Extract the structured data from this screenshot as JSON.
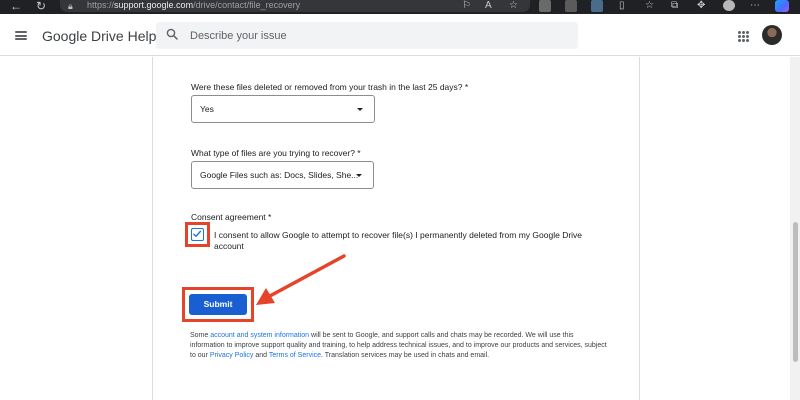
{
  "browser": {
    "url_prefix": "https://",
    "url_domain": "support.google.com",
    "url_path": "/drive/contact/file_recovery"
  },
  "header": {
    "title": "Google Drive Help",
    "search_placeholder": "Describe your issue"
  },
  "form": {
    "q1_label": "Were these files deleted or removed from your trash in the last 25 days? *",
    "q1_value": "Yes",
    "q2_label": "What type of files are you trying to recover? *",
    "q2_value": "Google Files such as: Docs, Slides, She...",
    "consent_label": "Consent agreement *",
    "consent_text": "I consent to allow Google to attempt to recover file(s) I permanently deleted from my Google Drive account",
    "consent_checked": true,
    "submit_label": "Submit"
  },
  "disclaimer": {
    "part1": "Some ",
    "link1": "account and system information",
    "part2": " will be sent to Google, and support calls and chats may be recorded. We will use this information to improve support quality and training, to help address technical issues, and to improve our products and services, subject to our ",
    "link2": "Privacy Policy",
    "part3": " and ",
    "link3": "Terms of Service",
    "part4": ". Translation services may be used in chats and email."
  },
  "colors": {
    "accent": "#1a73e8",
    "submit": "#1a5fd1",
    "annotation": "#e5432a"
  }
}
